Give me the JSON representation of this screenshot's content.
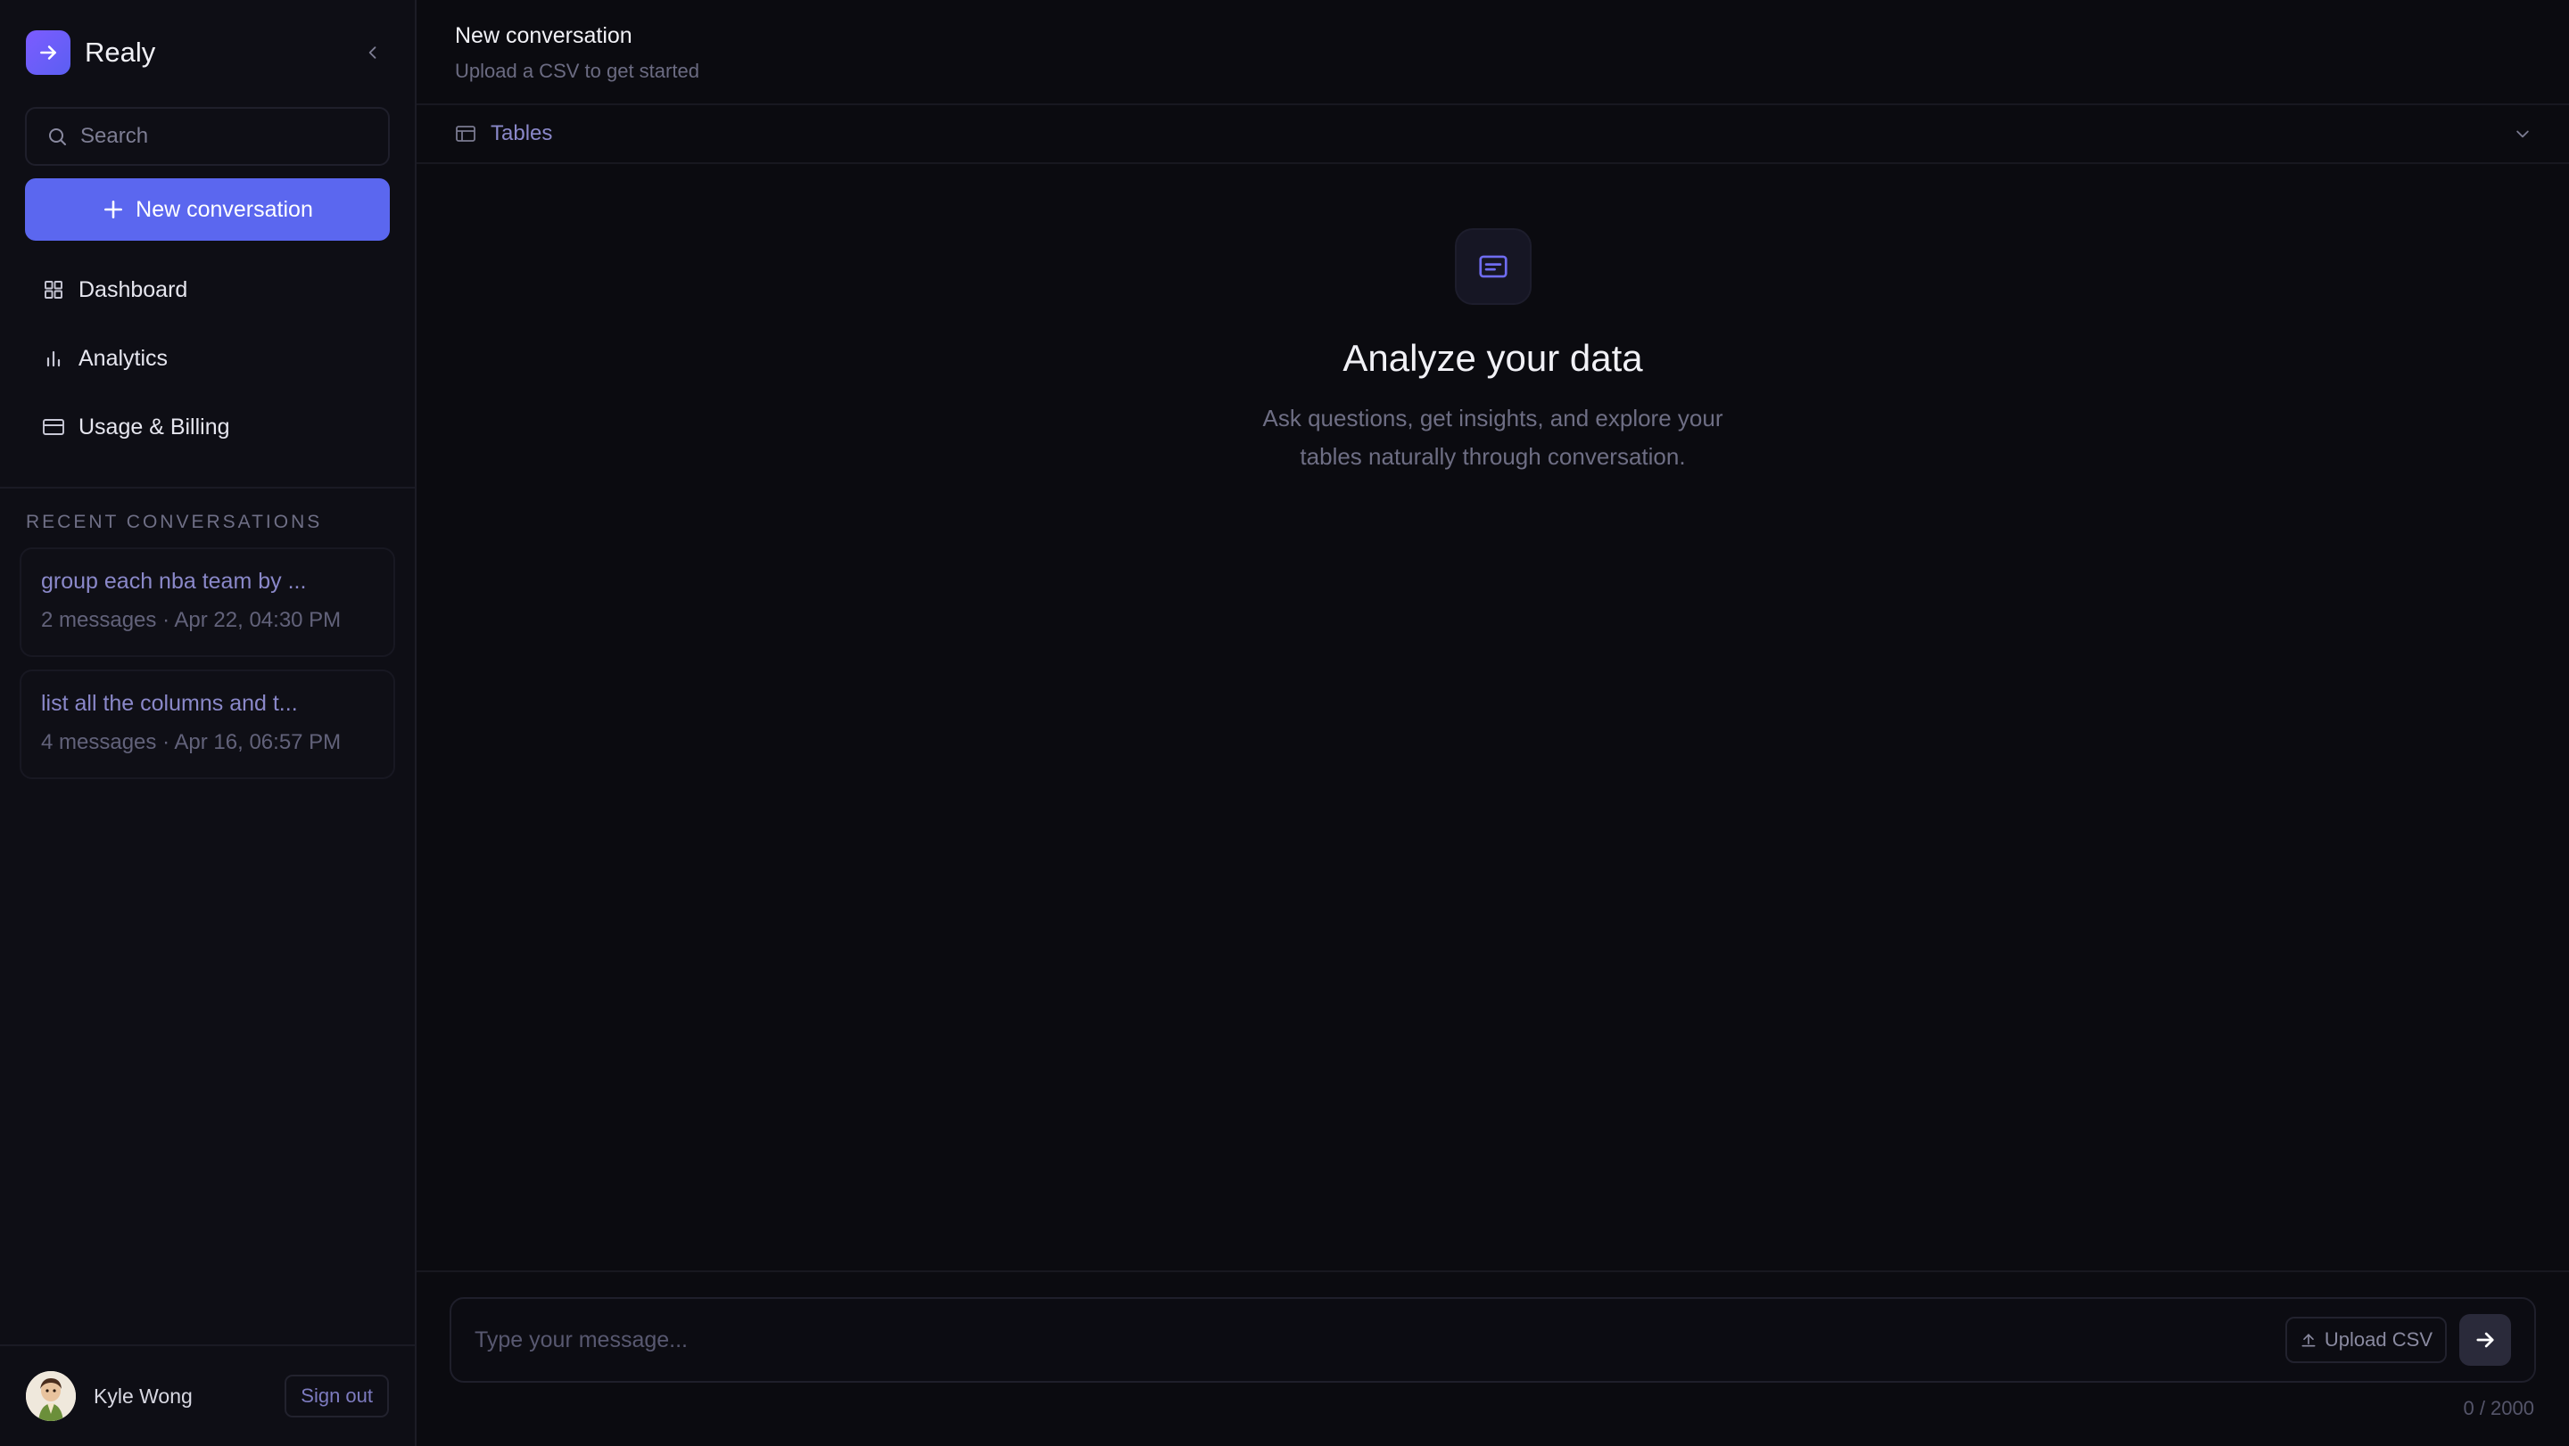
{
  "app": {
    "name": "Realy"
  },
  "sidebar": {
    "search_placeholder": "Search",
    "new_conversation_label": "New conversation",
    "nav": [
      {
        "label": "Dashboard",
        "icon": "grid-icon"
      },
      {
        "label": "Analytics",
        "icon": "bar-chart-icon"
      },
      {
        "label": "Usage & Billing",
        "icon": "credit-card-icon"
      }
    ],
    "recent_title": "RECENT CONVERSATIONS",
    "recent": [
      {
        "title": "group each nba team by ...",
        "meta": "2 messages · Apr 22, 04:30 PM"
      },
      {
        "title": "list all the columns and t...",
        "meta": "4 messages · Apr 16, 06:57 PM"
      }
    ],
    "user": {
      "name": "Kyle Wong",
      "signout_label": "Sign out"
    }
  },
  "header": {
    "title": "New conversation",
    "subtitle": "Upload a CSV to get started"
  },
  "tables_bar": {
    "label": "Tables"
  },
  "empty_state": {
    "title": "Analyze your data",
    "description": "Ask questions, get insights, and explore your tables naturally through conversation."
  },
  "composer": {
    "placeholder": "Type your message...",
    "upload_label": "Upload CSV",
    "counter": "0 / 2000"
  },
  "colors": {
    "accent": "#5b67ef",
    "background": "#0b0b10",
    "sidebar": "#0e0e15"
  }
}
